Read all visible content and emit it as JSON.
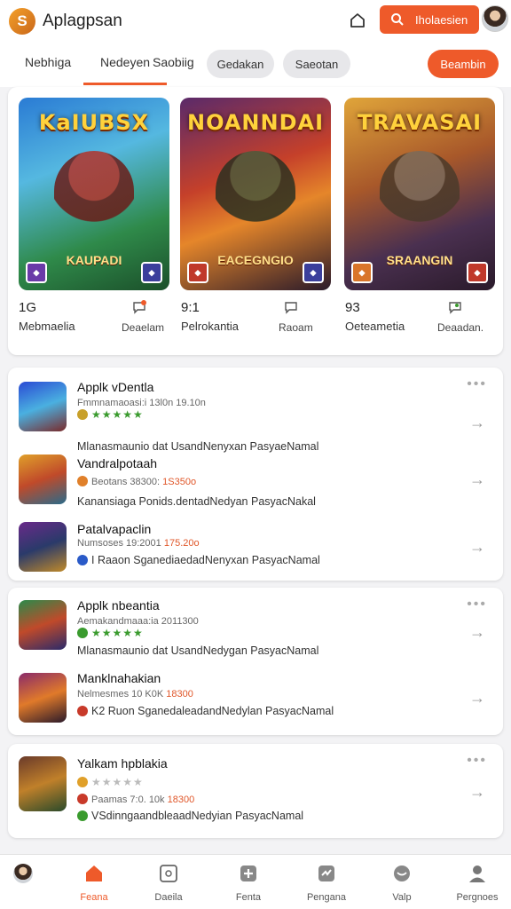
{
  "header": {
    "logo_letter": "S",
    "title": "Aplagpsan",
    "search_label": "Iholaesien"
  },
  "tabs": {
    "items": [
      "Nebhiga",
      "Nedeyen",
      "Saobiig",
      "Gedakan",
      "Saeotan"
    ],
    "active_index": 1,
    "cta": "Beambin"
  },
  "featured": {
    "games": [
      {
        "art_title": "KaIUBSX",
        "art_sub": "KAUPADI",
        "badge_left": "◆",
        "badge_right": "◆"
      },
      {
        "art_title": "NOANNDAI",
        "art_sub": "EACEGNGIO",
        "badge_left": "◆",
        "badge_right": "◆"
      },
      {
        "art_title": "TRAVASAI",
        "art_sub": "SRAANGIN",
        "badge_left": "◆",
        "badge_right": "◆"
      }
    ],
    "meta": [
      {
        "num": "1G",
        "label": "Mebmaelia",
        "action": "Deaelam"
      },
      {
        "num": "9:1",
        "label": "Pelrokantia",
        "action": "Raoam"
      },
      {
        "num": "93",
        "label": "Oeteametia",
        "action": "Deaadan."
      }
    ]
  },
  "section1": {
    "rows": [
      {
        "title": "Applk vDentla",
        "meta": "Fmmnamaoasi:i 13l0n 19.10n",
        "rating": "★★★★★",
        "meta_hl": "",
        "desc": "Mlanasmaunio dat UsandNenyxan PasyaeNamal"
      },
      {
        "title": "Vandralpotaah",
        "meta": "Beotans 38300:",
        "rating": "",
        "meta_hl": "1S350o",
        "desc": "Kanansiaga Ponids.dentadNedyan PasyacNakal"
      },
      {
        "title": "Patalvapaclin",
        "meta": "Numsoses 19:2001",
        "rating": "",
        "meta_hl": "175.20o",
        "desc": "I Raaon SganediaedadNenyxan PasyacNamal"
      }
    ]
  },
  "section2": {
    "rows": [
      {
        "title": "Applk nbeantia",
        "meta": "Aemakandmaaa:ia 2011300",
        "rating": "★★★★★",
        "meta_hl": "",
        "desc": "Mlanasmaunio dat UsandNedygan PasyacNamal"
      },
      {
        "title": "Manklnahakian",
        "meta": "Nelmesmes 10 K0K",
        "rating": "",
        "meta_hl": "18300",
        "desc": "K2 Ruon SganedaleadandNedylan PasyacNamal"
      }
    ]
  },
  "section3": {
    "rows": [
      {
        "title": "Yalkam hpblakia",
        "meta": "",
        "rating": "★★★★★",
        "meta_hl": "",
        "desc": ""
      },
      {
        "title": "",
        "meta": "Paamas 7:0. 10k",
        "rating": "",
        "meta_hl": "18300",
        "desc": ""
      },
      {
        "title": "",
        "meta": "",
        "rating": "",
        "meta_hl": "",
        "desc": "VSdinngaandbleaadNedyian PasyacNamal"
      }
    ]
  },
  "bottom_nav": {
    "items": [
      "",
      "Feana",
      "Daeila",
      "Fenta",
      "Pengana",
      "Valp",
      "Pergnoes"
    ],
    "active_index": 1
  },
  "colors": {
    "accent": "#ee5a2a",
    "rating_green": "#3a9b2e"
  }
}
